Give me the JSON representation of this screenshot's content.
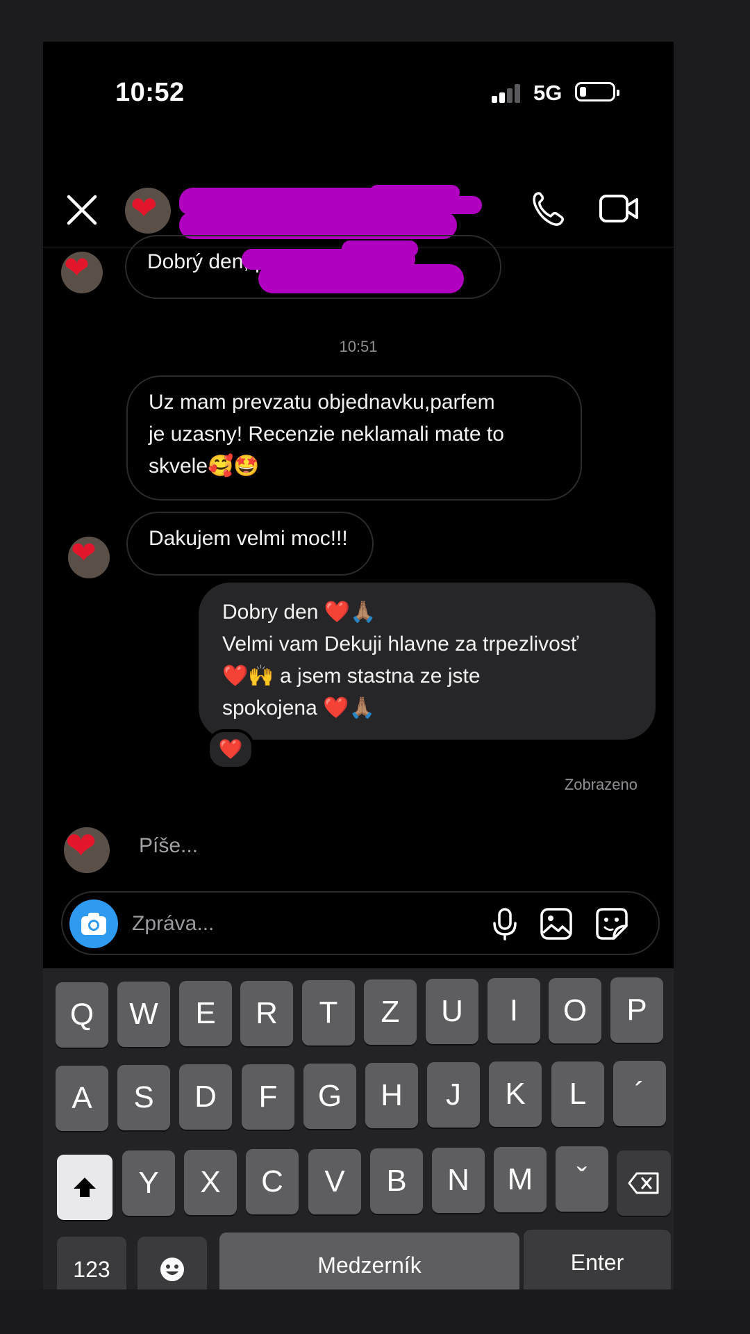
{
  "status_bar": {
    "time": "10:52",
    "network": "5G"
  },
  "header": {
    "name": "",
    "avatar_icon": "heart-icon"
  },
  "messages": {
    "first_in": "Dobrý den, p",
    "timestamp": "10:51",
    "second_in_line1": "Uz mam prevzatu objednavku,parfem",
    "second_in_line2": "je uzasny! Recenzie neklamali mate to",
    "second_in_line3": "skvele🥰🤩",
    "third_in": "Dakujem velmi moc!!!",
    "out_line1": "Dobry den ❤️🙏🏽",
    "out_line2": "Velmi vam Dekuji hlavne za trpezlivosť",
    "out_line3": "❤️🙌 a jsem stastna ze jste",
    "out_line4": "spokojena ❤️🙏🏽",
    "reaction": "❤️",
    "seen_label": "Zobrazeno",
    "typing_label": "Píše..."
  },
  "composer": {
    "placeholder": "Zpráva..."
  },
  "keyboard": {
    "row1": [
      "Q",
      "W",
      "E",
      "R",
      "T",
      "Z",
      "U",
      "I",
      "O",
      "P"
    ],
    "row2": [
      "A",
      "S",
      "D",
      "F",
      "G",
      "H",
      "J",
      "K",
      "L",
      "´"
    ],
    "row3": [
      "Y",
      "X",
      "C",
      "V",
      "B",
      "N",
      "M",
      "ˇ"
    ],
    "numbers_label": "123",
    "space_label": "Medzerník",
    "enter_label": "Enter"
  },
  "colors": {
    "accent_blue": "#2e9bf0",
    "redaction": "#b000c0",
    "heart_red": "#e4162b",
    "bubble_out": "#262628"
  }
}
